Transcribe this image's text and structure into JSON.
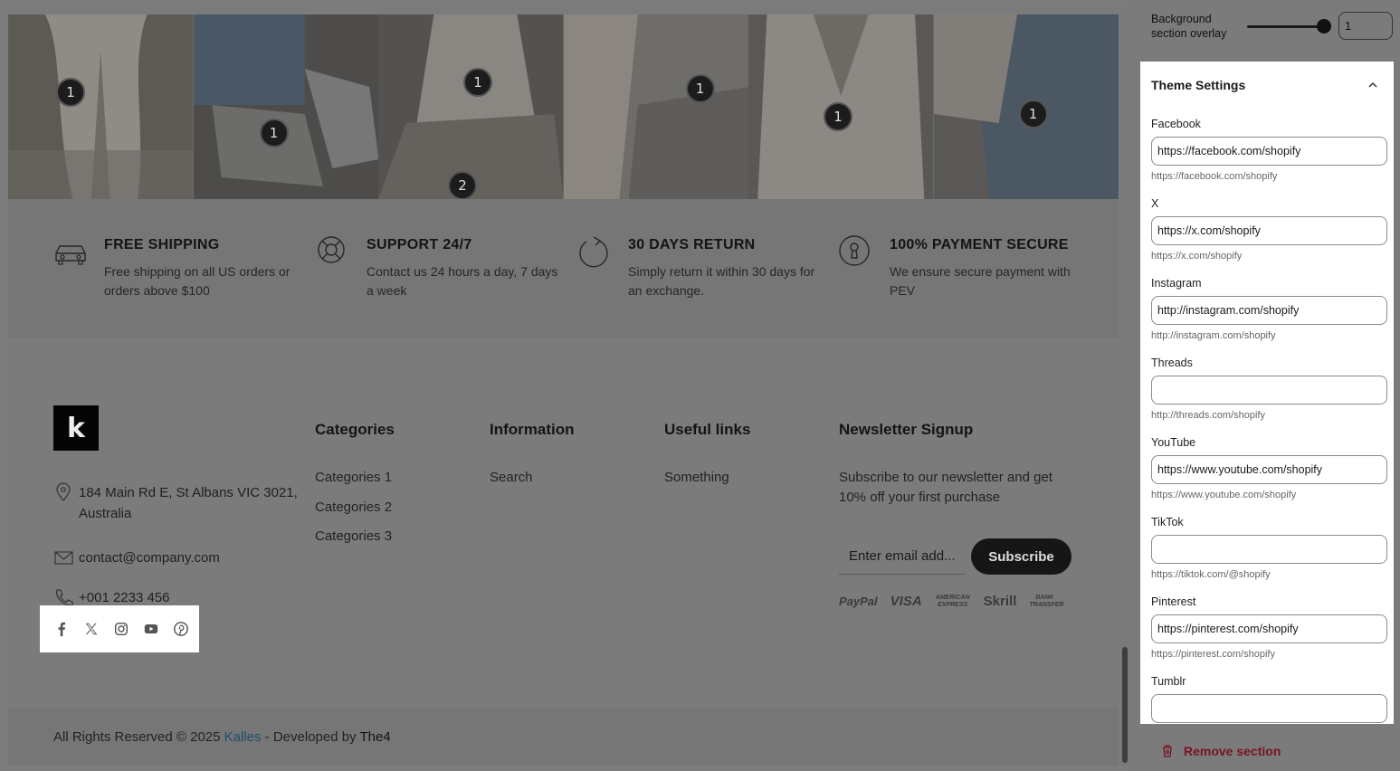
{
  "gallery": {
    "tiles": [
      {
        "hotspots": [
          "1"
        ]
      },
      {
        "hotspots": [
          "1"
        ]
      },
      {
        "hotspots": [
          "1",
          "2"
        ]
      },
      {
        "hotspots": [
          "1"
        ]
      },
      {
        "hotspots": [
          "1"
        ]
      },
      {
        "hotspots": [
          "1"
        ]
      }
    ]
  },
  "features": [
    {
      "icon": "car-icon",
      "title": "FREE SHIPPING",
      "desc": "Free shipping on all US orders or orders above $100"
    },
    {
      "icon": "lifebuoy-icon",
      "title": "SUPPORT 24/7",
      "desc": "Contact us 24 hours a day, 7 days a week"
    },
    {
      "icon": "refresh-icon",
      "title": "30 DAYS RETURN",
      "desc": "Simply return it within 30 days for an exchange."
    },
    {
      "icon": "keyhole-icon",
      "title": "100% PAYMENT SECURE",
      "desc": "We ensure secure payment with PEV"
    }
  ],
  "footer": {
    "logo_letter": "k",
    "address": "184 Main Rd E, St Albans VIC 3021, Australia",
    "email": "contact@company.com",
    "phone": "+001 2233 456",
    "socials": [
      "facebook-icon",
      "x-icon",
      "instagram-icon",
      "youtube-icon",
      "pinterest-icon"
    ],
    "columns": [
      {
        "heading": "Categories",
        "links": [
          "Categories 1",
          "Categories 2",
          "Categories 3"
        ]
      },
      {
        "heading": "Information",
        "links": [
          "Search"
        ]
      },
      {
        "heading": "Useful links",
        "links": [
          "Something"
        ]
      }
    ],
    "newsletter": {
      "heading": "Newsletter Signup",
      "text": "Subscribe to our newsletter and get 10% off your first purchase",
      "placeholder": "Enter email add...",
      "button": "Subscribe"
    },
    "payments": [
      "PayPal",
      "VISA",
      "AMERICAN EXPRESS",
      "Skrill",
      "BANK TRANSFER"
    ],
    "copyright": {
      "prefix": "All Rights Reserved © 2025 ",
      "brand": "Kalles",
      "middle": " - Developed by ",
      "developer": "The4"
    }
  },
  "panel": {
    "overlay_label": "Background section overlay",
    "overlay_value": "1",
    "theme_settings_title": "Theme Settings",
    "fields": [
      {
        "label": "Facebook",
        "value": "https://facebook.com/shopify",
        "help": "https://facebook.com/shopify"
      },
      {
        "label": "X",
        "value": "https://x.com/shopify",
        "help": "https://x.com/shopify"
      },
      {
        "label": "Instagram",
        "value": "http://instagram.com/shopify",
        "help": "http://instagram.com/shopify"
      },
      {
        "label": "Threads",
        "value": "",
        "help": "http://threads.com/shopify"
      },
      {
        "label": "YouTube",
        "value": "https://www.youtube.com/shopify",
        "help": "https://www.youtube.com/shopify"
      },
      {
        "label": "TikTok",
        "value": "",
        "help": "https://tiktok.com/@shopify"
      },
      {
        "label": "Pinterest",
        "value": "https://pinterest.com/shopify",
        "help": "https://pinterest.com/shopify"
      },
      {
        "label": "Tumblr",
        "value": "",
        "help": ""
      }
    ],
    "remove_section": "Remove section"
  },
  "colors": {
    "dim_overlay": "#7b7b7b",
    "remove_red": "#7a1224",
    "brand_link": "#1b4f6b"
  }
}
